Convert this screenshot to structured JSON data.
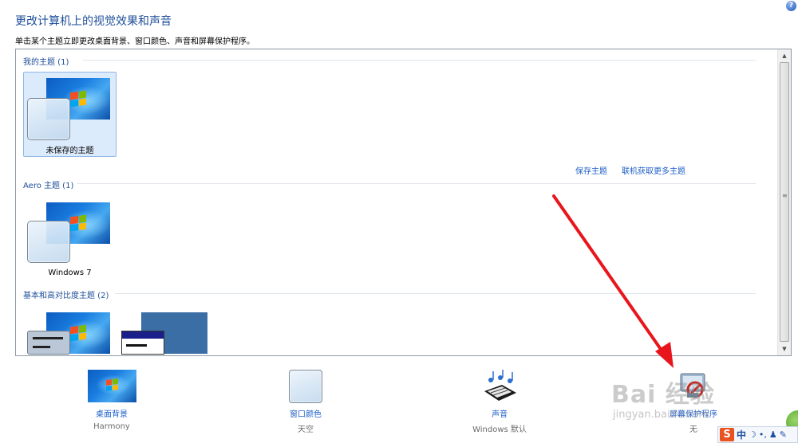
{
  "header": {
    "title": "更改计算机上的视觉效果和声音",
    "subtitle": "单击某个主题立即更改桌面背景、窗口颜色、声音和屏幕保护程序。",
    "help_glyph": "?"
  },
  "groups": {
    "my_themes": {
      "label": "我的主题 (1)",
      "items": [
        {
          "label": "未保存的主题",
          "selected": true
        }
      ]
    },
    "aero_themes": {
      "label": "Aero 主题 (1)",
      "items": [
        {
          "label": "Windows 7"
        }
      ]
    },
    "basic_themes": {
      "label": "基本和高对比度主题 (2)"
    }
  },
  "links": {
    "save_theme": "保存主题",
    "get_more": "联机获取更多主题"
  },
  "bottom": {
    "desktop_bg": {
      "label": "桌面背景",
      "value": "Harmony"
    },
    "window_color": {
      "label": "窗口颜色",
      "value": "天空"
    },
    "sound": {
      "label": "声音",
      "value": "Windows 默认"
    },
    "screensaver": {
      "label": "屏幕保护程序",
      "value": "无"
    }
  },
  "watermark": {
    "main": "Bai 经验",
    "sub": "jingyan.baidu.com"
  },
  "ime": {
    "logo": "S",
    "mode": "中"
  },
  "colors": {
    "accent": "#1e4e9a",
    "link": "#1e5fc7",
    "annotation_arrow": "#e8161c"
  }
}
